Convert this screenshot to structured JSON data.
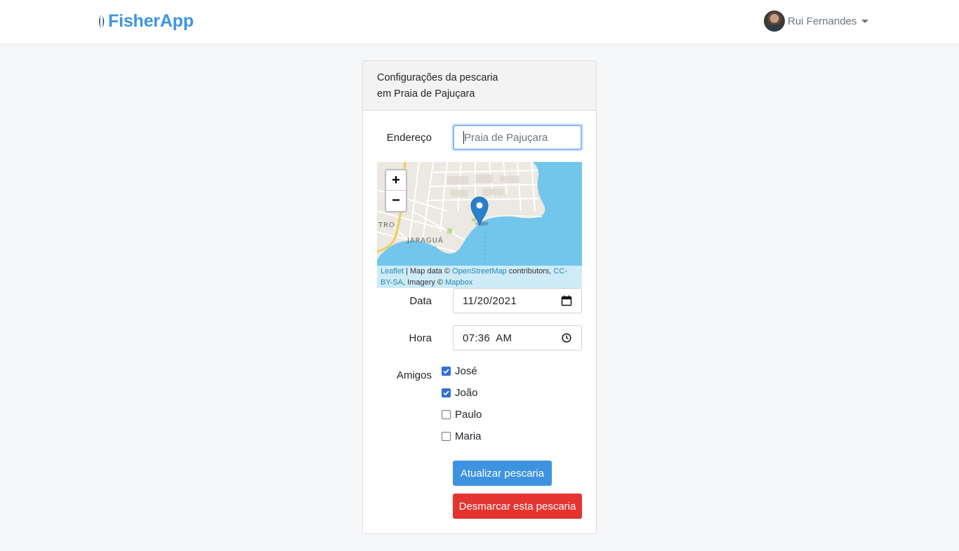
{
  "navbar": {
    "brand_fisher": "Fisher",
    "brand_app": "App",
    "user_name": "Rui Fernandes"
  },
  "card": {
    "header_line1": "Configurações da pescaria",
    "header_line2": "em Praia de Pajuçara"
  },
  "form": {
    "address_label": "Endereço",
    "address_placeholder": "Praia de Pajuçara",
    "date_label": "Data",
    "date_value": "11/20/2021",
    "time_label": "Hora",
    "time_value": "07:36  AM",
    "friends_label": "Amigos",
    "friends": [
      {
        "name": "José",
        "checked": true
      },
      {
        "name": "João",
        "checked": true
      },
      {
        "name": "Paulo",
        "checked": false
      },
      {
        "name": "Maria",
        "checked": false
      }
    ],
    "update_button": "Atualizar pescaria",
    "cancel_button": "Desmarcar esta pescaria"
  },
  "map": {
    "zoom_in": "+",
    "zoom_out": "−",
    "label_jaragua": "JARAGUÁ",
    "label_centro": "TRO",
    "attribution": {
      "leaflet": "Leaflet",
      "sep1": " | Map data © ",
      "osm": "OpenStreetMap",
      "contributors": " contributors, ",
      "license": "CC-BY-SA",
      "imagery": ", Imagery © ",
      "mapbox": "Mapbox"
    },
    "water_color": "#72c6ec",
    "marker_color": "#2a81cb"
  },
  "colors": {
    "primary": "#3d93e0",
    "danger": "#e3342f",
    "checkbox_checked": "#2f6fd6"
  }
}
